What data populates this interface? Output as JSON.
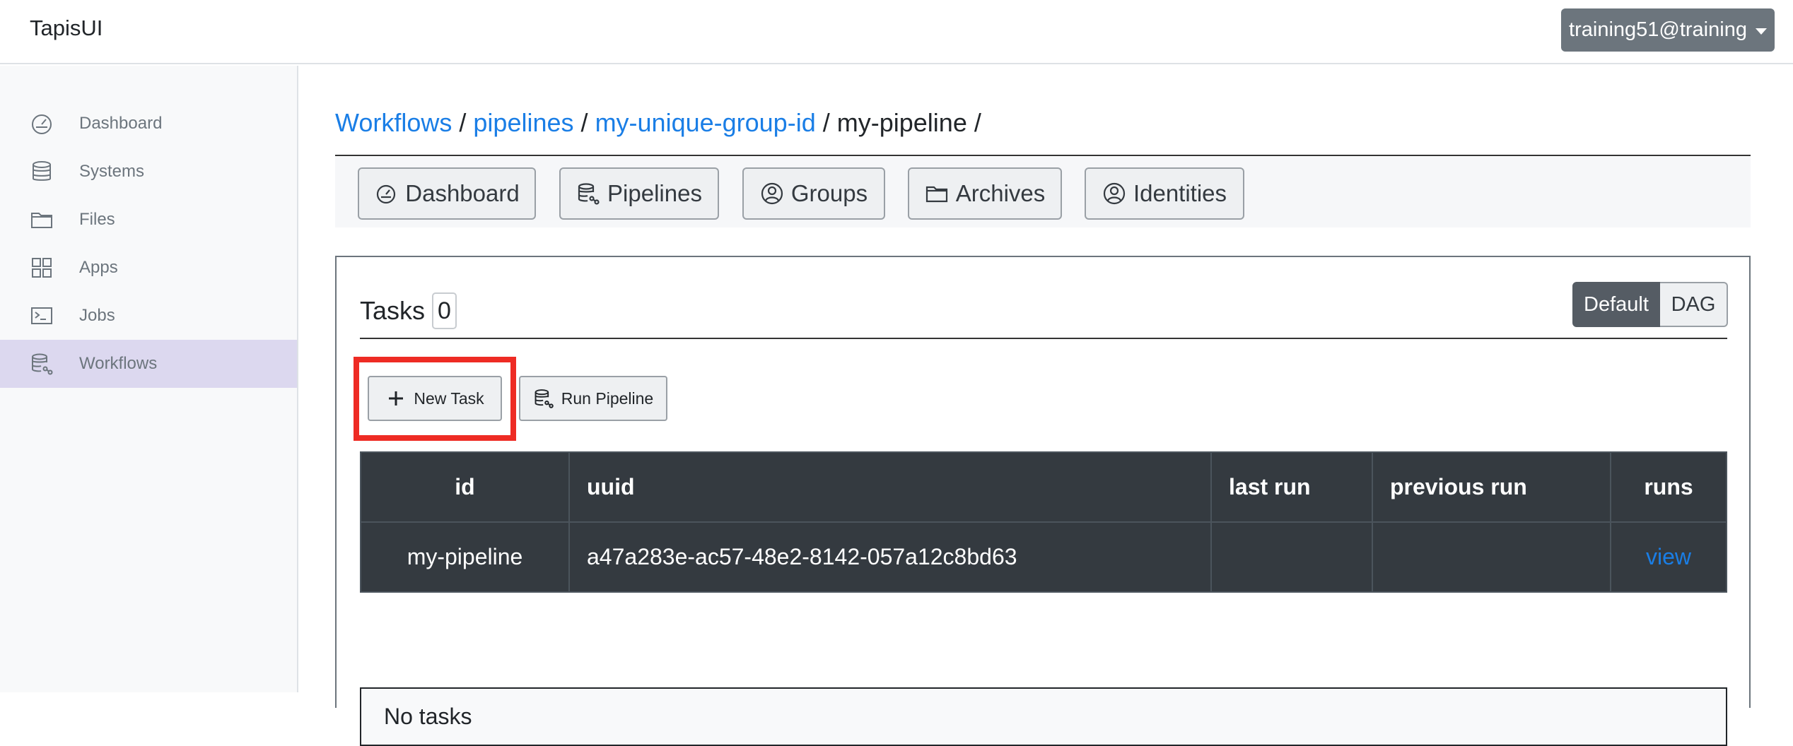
{
  "app": {
    "brand": "TapisUI"
  },
  "user": {
    "label": "training51@training"
  },
  "sidebar": {
    "items": [
      {
        "label": "Dashboard",
        "icon": "dashboard-icon"
      },
      {
        "label": "Systems",
        "icon": "database-icon"
      },
      {
        "label": "Files",
        "icon": "folder-icon"
      },
      {
        "label": "Apps",
        "icon": "grid-icon"
      },
      {
        "label": "Jobs",
        "icon": "terminal-icon"
      },
      {
        "label": "Workflows",
        "icon": "workflows-icon",
        "active": true
      }
    ]
  },
  "breadcrumb": {
    "items": [
      {
        "label": "Workflows",
        "link": true
      },
      {
        "label": "pipelines",
        "link": true
      },
      {
        "label": "my-unique-group-id",
        "link": true
      },
      {
        "label": "my-pipeline",
        "link": false
      }
    ],
    "separator": "/"
  },
  "toolbar": {
    "buttons": [
      {
        "label": "Dashboard",
        "icon": "dashboard-icon"
      },
      {
        "label": "Pipelines",
        "icon": "workflows-icon"
      },
      {
        "label": "Groups",
        "icon": "user-circle-icon"
      },
      {
        "label": "Archives",
        "icon": "folder-icon"
      },
      {
        "label": "Identities",
        "icon": "user-circle-icon"
      }
    ]
  },
  "tasks": {
    "title": "Tasks",
    "count": "0",
    "view_toggle": {
      "default": "Default",
      "dag": "DAG",
      "selected": "Default"
    },
    "actions": {
      "new_task": "New Task",
      "run_pipeline": "Run Pipeline"
    },
    "table": {
      "headers": [
        "id",
        "uuid",
        "last run",
        "previous run",
        "runs"
      ],
      "rows": [
        {
          "id": "my-pipeline",
          "uuid": "a47a283e-ac57-48e2-8142-057a12c8bd63",
          "last_run": "",
          "previous_run": "",
          "runs": "view"
        }
      ]
    },
    "empty_message": "No tasks"
  },
  "colors": {
    "accent": "#1a7ee6",
    "active_nav": "#dcd8ef",
    "table_dark": "#343a40",
    "highlight": "#ee2b24"
  }
}
